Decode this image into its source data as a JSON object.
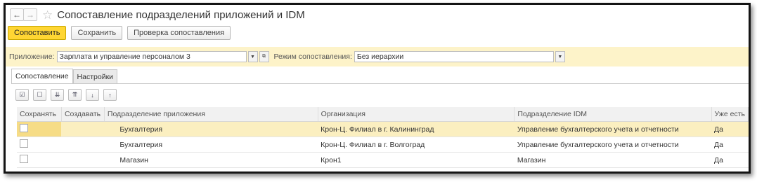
{
  "window": {
    "title": "Сопоставление подразделений приложений и IDM",
    "back_icon": "←",
    "forward_icon": "→",
    "star_icon": "☆"
  },
  "toolbar": {
    "match_label": "Сопоставить",
    "save_label": "Сохранить",
    "check_label": "Проверка сопоставления"
  },
  "params": {
    "app_label": "Приложение:",
    "app_value": "Зарплата и управление персоналом 3",
    "mode_label": "Режим сопоставления:",
    "mode_value": "Без иерархии"
  },
  "tabs": [
    {
      "label": "Сопоставление"
    },
    {
      "label": "Настройки"
    }
  ],
  "grid": {
    "columns": [
      "Сохранять",
      "Создавать",
      "Подразделение приложения",
      "Организация",
      "Подразделение IDM",
      "Уже есть"
    ],
    "rows": [
      {
        "save": "",
        "create": "",
        "app_unit": "Бухгалтерия",
        "org": "Крон-Ц. Филиал в г. Калининград",
        "idm_unit": "Управление бухгалтерского учета и отчетности",
        "exists": "Да"
      },
      {
        "save": "",
        "create": "",
        "app_unit": "Бухгалтерия",
        "org": "Крон-Ц. Филиал в г. Волгоград",
        "idm_unit": "Управление бухгалтерского учета и отчетности",
        "exists": "Да"
      },
      {
        "save": "",
        "create": "",
        "app_unit": "Магазин",
        "org": "Крон1",
        "idm_unit": "Магазин",
        "exists": "Да"
      }
    ]
  },
  "colors": {
    "accent": "#ffd633",
    "param_bg": "#fdf3c9",
    "selected_row": "#fbefc0"
  }
}
